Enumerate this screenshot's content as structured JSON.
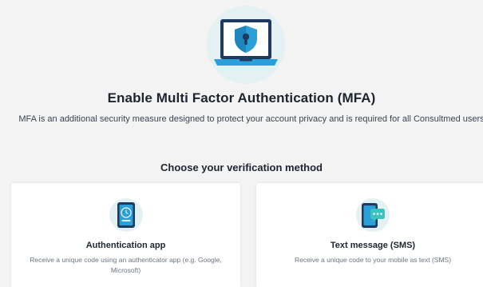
{
  "header": {
    "hero_icon": "laptop-shield-lock-icon",
    "title": "Enable Multi Factor Authentication (MFA)",
    "description": "MFA is an additional security measure designed to protect your account privacy and is required for all Consultmed users"
  },
  "section": {
    "heading": "Choose your verification method"
  },
  "methods": [
    {
      "icon": "authenticator-phone-icon",
      "title": "Authentication app",
      "description": "Receive a unique code using an authenticator app (e.g. Google, Microsoft)"
    },
    {
      "icon": "sms-phone-icon",
      "title": "Text message (SMS)",
      "description": "Receive a unique code to your mobile as text (SMS)"
    }
  ],
  "colors": {
    "accent_blue": "#2a9fd8",
    "dark_navy": "#1e3a5f",
    "teal_bubble": "#3cc3c0",
    "background": "#f3f3f3"
  }
}
